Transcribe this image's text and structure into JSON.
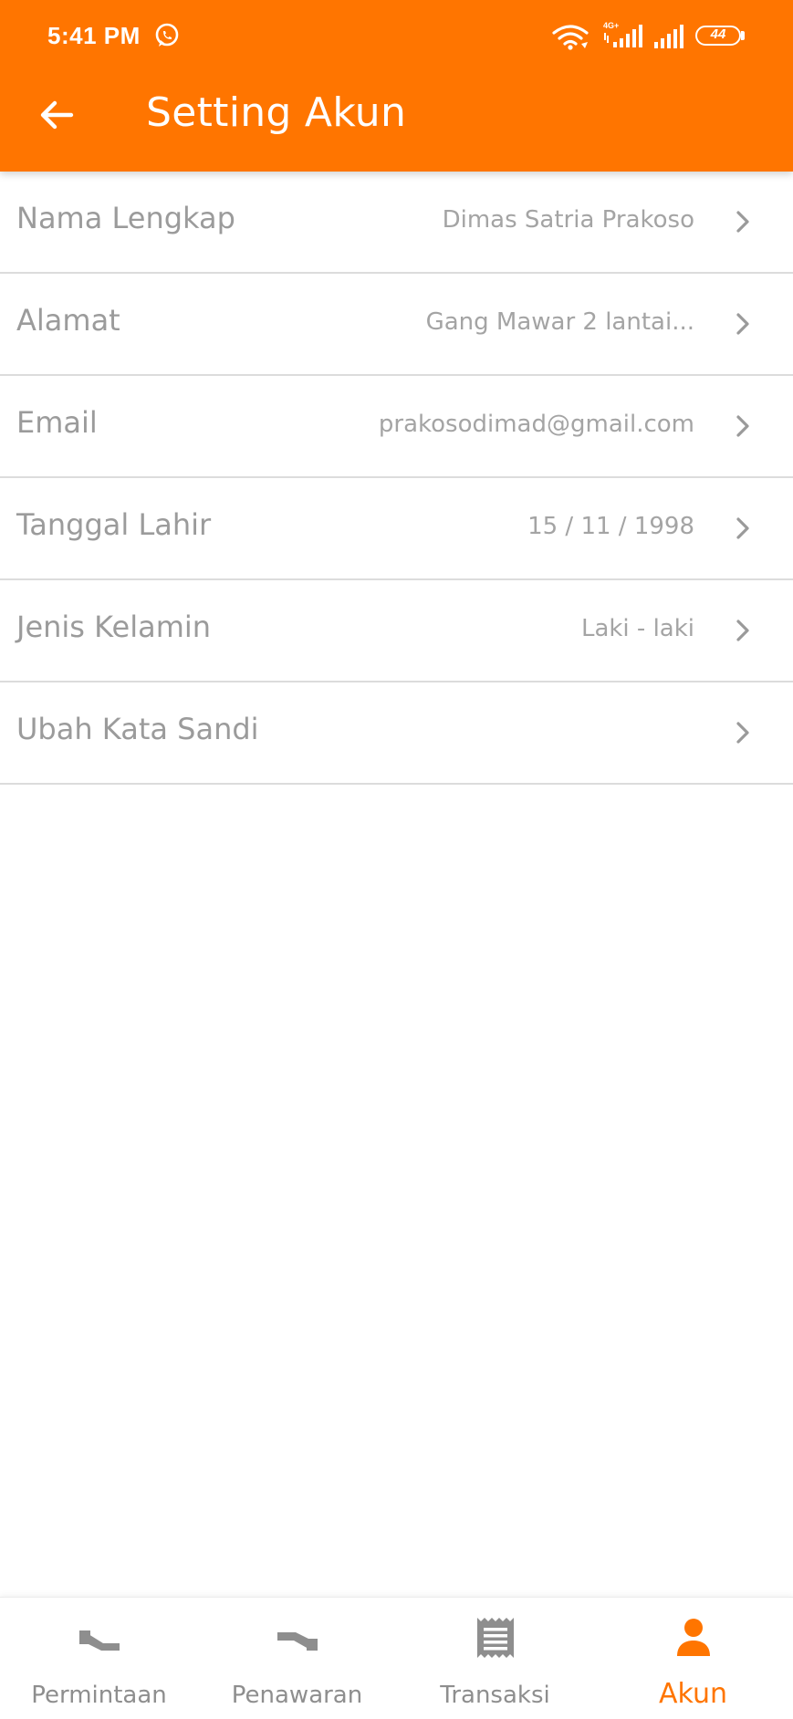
{
  "status_bar": {
    "time": "5:41 PM",
    "app_icon": "whatsapp-icon",
    "network_label": "4G+",
    "battery": "44"
  },
  "app_bar": {
    "title": "Setting Akun",
    "back_icon": "arrow-left-icon",
    "background": "#FF7500"
  },
  "settings": [
    {
      "label": "Nama Lengkap",
      "value": "Dimas Satria Prakoso"
    },
    {
      "label": "Alamat",
      "value": "Gang Mawar 2 lantai..."
    },
    {
      "label": "Email",
      "value": "prakosodimad@gmail.com"
    },
    {
      "label": "Tanggal Lahir",
      "value": "15 / 11 / 1998"
    },
    {
      "label": "Jenis Kelamin",
      "value": "Laki - laki"
    },
    {
      "label": "Ubah Kata Sandi",
      "value": ""
    }
  ],
  "bottom_nav": [
    {
      "label": "Permintaan",
      "icon": "handshake-out-icon",
      "active": false
    },
    {
      "label": "Penawaran",
      "icon": "handshake-in-icon",
      "active": false
    },
    {
      "label": "Transaksi",
      "icon": "receipt-icon",
      "active": false
    },
    {
      "label": "Akun",
      "icon": "person-icon",
      "active": true
    }
  ],
  "colors": {
    "accent": "#FF7500",
    "inactive": "#8E8E8E",
    "text_label": "#9B9B9B",
    "divider": "#DCDCDC"
  }
}
